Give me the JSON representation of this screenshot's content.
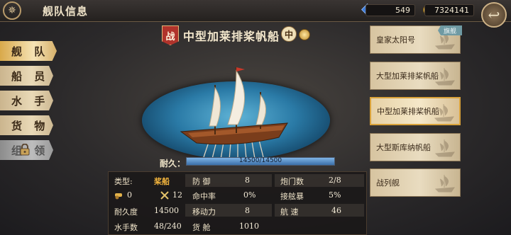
{
  "header": {
    "title": "舰队信息"
  },
  "currency": {
    "gems": "549",
    "gold": "7324141"
  },
  "tabs": [
    {
      "label": "舰 队",
      "active": true
    },
    {
      "label": "船 员"
    },
    {
      "label": "水 手"
    },
    {
      "label": "货 物"
    },
    {
      "label": "组 领",
      "locked": true
    }
  ],
  "ship": {
    "type_badge": "战",
    "name": "中型加莱排桨帆船",
    "size_badge": "中",
    "durability_label": "耐久：",
    "durability_text": "14500/14500",
    "durability_fraction": 1.0
  },
  "stats": {
    "type_label": "类型:",
    "type_value": "桨船",
    "cannon_label_short": "0",
    "crossed_swords": "12",
    "durability_label": "耐久度",
    "durability_value": "14500",
    "sailors_label": "水手数",
    "sailors_value": "48/240",
    "defense_label": "防 御",
    "defense_value": "8",
    "accuracy_label": "命中率",
    "accuracy_value": "0%",
    "mobility_label": "移动力",
    "mobility_value": "8",
    "cargo_label": "货 舱",
    "cargo_value": "1010",
    "gunports_label": "炮门数",
    "gunports_value": "2/8",
    "boarding_label": "接舷暴",
    "boarding_value": "5%",
    "speed_label": "航 速",
    "speed_value": "46"
  },
  "ship_list": [
    {
      "name": "皇家太阳号",
      "tag": "旗舰"
    },
    {
      "name": "大型加莱排桨帆船"
    },
    {
      "name": "中型加莱排桨帆船",
      "selected": true
    },
    {
      "name": "大型斯库纳帆船"
    },
    {
      "name": "战列舰"
    }
  ],
  "colors": {
    "accent": "#d9a23a",
    "highlight": "#f2b43d",
    "sea": "#2a7aa6"
  }
}
